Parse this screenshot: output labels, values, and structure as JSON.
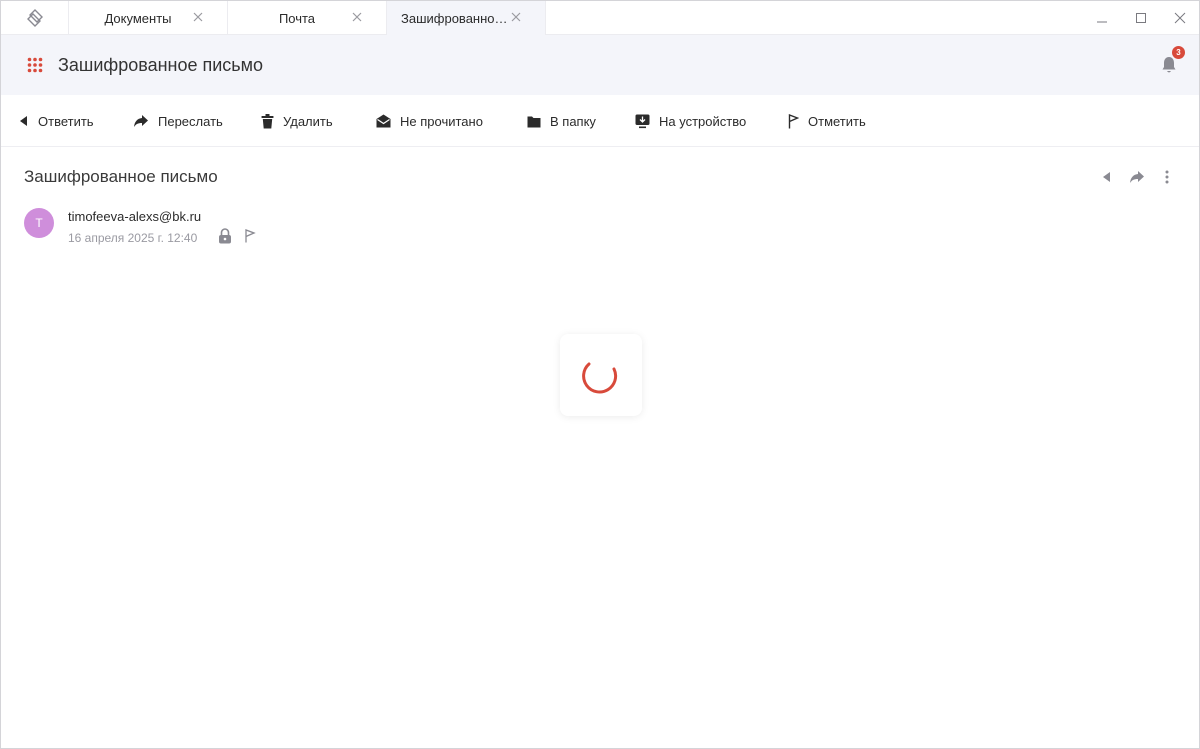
{
  "tabs": [
    {
      "label": "Документы",
      "active": false
    },
    {
      "label": "Почта",
      "active": false
    },
    {
      "label": "Зашифрованное письмо",
      "active": true
    }
  ],
  "header": {
    "title": "Зашифрованное письмо",
    "notifications_count": "3"
  },
  "toolbar": {
    "reply": "Ответить",
    "forward": "Переслать",
    "delete": "Удалить",
    "unread": "Не прочитано",
    "to_folder": "В папку",
    "to_device": "На устройство",
    "mark": "Отметить"
  },
  "message": {
    "subject": "Зашифрованное письмо",
    "avatar_letter": "T",
    "sender": "timofeeva-alexs@bk.ru",
    "date": "16 апреля 2025 г. 12:40"
  },
  "colors": {
    "accent": "#d84a3b",
    "header_bg": "#f4f5fa",
    "avatar_bg": "#cf8edb"
  },
  "icons": {
    "app_logo": "app-logo-icon",
    "close": "close-icon",
    "minimize": "minimize-icon",
    "maximize": "maximize-icon",
    "apps_grid": "apps-grid-icon",
    "bell": "bell-icon",
    "reply": "reply-icon",
    "forward": "forward-icon",
    "trash": "trash-icon",
    "envelope_open": "envelope-open-icon",
    "folder": "folder-icon",
    "download_device": "device-download-icon",
    "flag": "flag-icon",
    "lock": "lock-icon",
    "more": "more-vertical-icon",
    "spinner": "spinner-icon"
  }
}
